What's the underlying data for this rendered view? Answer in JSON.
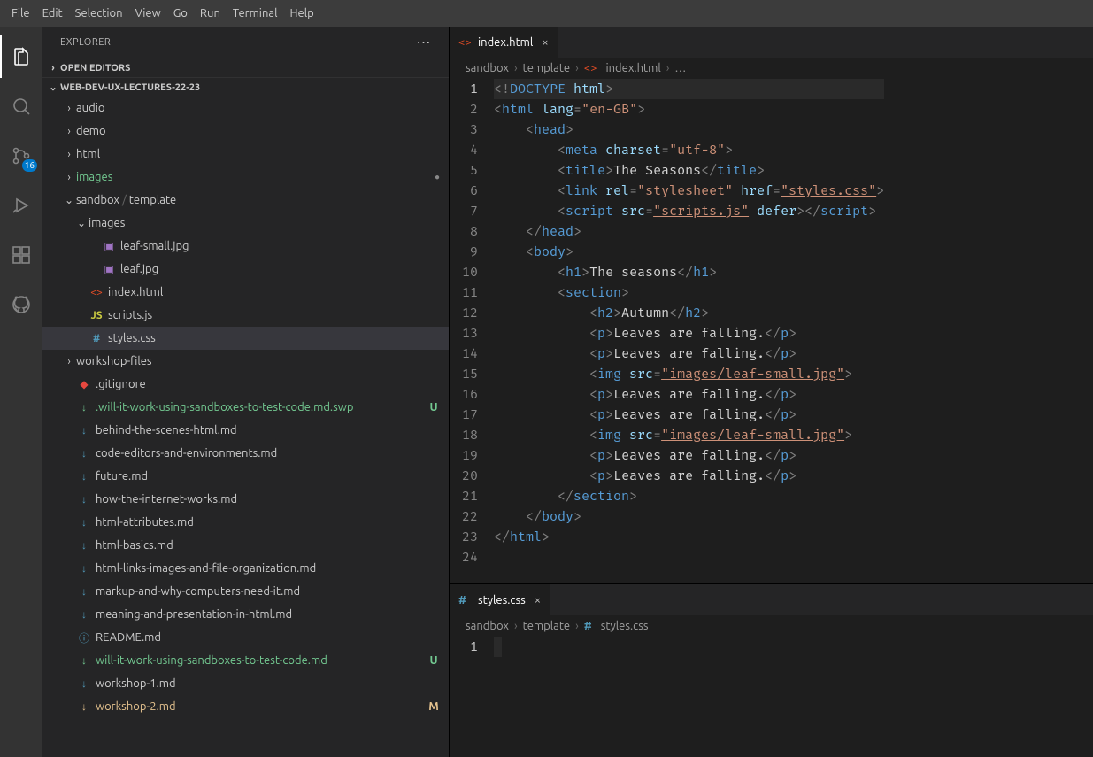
{
  "menu": [
    "File",
    "Edit",
    "Selection",
    "View",
    "Go",
    "Run",
    "Terminal",
    "Help"
  ],
  "sidebar": {
    "title": "EXPLORER",
    "sections": {
      "open_editors": "OPEN EDITORS",
      "folder": "WEB-DEV-UX-LECTURES-22-23"
    }
  },
  "scm_badge": "16",
  "tree": [
    {
      "depth": 1,
      "chev": ">",
      "type": "folder",
      "label": "audio"
    },
    {
      "depth": 1,
      "chev": ">",
      "type": "folder",
      "label": "demo"
    },
    {
      "depth": 1,
      "chev": ">",
      "type": "folder",
      "label": "html"
    },
    {
      "depth": 1,
      "chev": ">",
      "type": "folder",
      "label": "images",
      "status": "untracked",
      "dot": true
    },
    {
      "depth": 1,
      "chev": "v",
      "type": "folder",
      "label": "sandbox / template",
      "breadcrumb": true
    },
    {
      "depth": 2,
      "chev": "v",
      "type": "folder",
      "label": "images"
    },
    {
      "depth": 3,
      "type": "image",
      "label": "leaf-small.jpg"
    },
    {
      "depth": 3,
      "type": "image",
      "label": "leaf.jpg"
    },
    {
      "depth": 2,
      "type": "html",
      "label": "index.html"
    },
    {
      "depth": 2,
      "type": "js",
      "label": "scripts.js"
    },
    {
      "depth": 2,
      "type": "css",
      "label": "styles.css",
      "selected": true
    },
    {
      "depth": 1,
      "chev": ">",
      "type": "folder",
      "label": "workshop-files"
    },
    {
      "depth": 1,
      "type": "git",
      "label": ".gitignore"
    },
    {
      "depth": 1,
      "type": "md",
      "label": ".will-it-work-using-sandboxes-to-test-code.md.swp",
      "status": "untracked",
      "git": "U"
    },
    {
      "depth": 1,
      "type": "md",
      "label": "behind-the-scenes-html.md"
    },
    {
      "depth": 1,
      "type": "md",
      "label": "code-editors-and-environments.md"
    },
    {
      "depth": 1,
      "type": "md",
      "label": "future.md"
    },
    {
      "depth": 1,
      "type": "md",
      "label": "how-the-internet-works.md"
    },
    {
      "depth": 1,
      "type": "md",
      "label": "html-attributes.md"
    },
    {
      "depth": 1,
      "type": "md",
      "label": "html-basics.md"
    },
    {
      "depth": 1,
      "type": "md",
      "label": "html-links-images-and-file-organization.md"
    },
    {
      "depth": 1,
      "type": "md",
      "label": "markup-and-why-computers-need-it.md"
    },
    {
      "depth": 1,
      "type": "md",
      "label": "meaning-and-presentation-in-html.md"
    },
    {
      "depth": 1,
      "type": "info",
      "label": "README.md"
    },
    {
      "depth": 1,
      "type": "md",
      "label": "will-it-work-using-sandboxes-to-test-code.md",
      "status": "untracked",
      "git": "U"
    },
    {
      "depth": 1,
      "type": "md",
      "label": "workshop-1.md"
    },
    {
      "depth": 1,
      "type": "md",
      "label": "workshop-2.md",
      "status": "modified",
      "git": "M"
    }
  ],
  "top_editor": {
    "tab": {
      "icon": "html",
      "label": "index.html"
    },
    "breadcrumb": [
      "sandbox",
      "template",
      "index.html",
      "…"
    ],
    "breadcrumb_icons": [
      null,
      null,
      "html",
      null
    ],
    "lines": [
      [
        [
          "a",
          "<"
        ],
        [
          "b",
          "!"
        ],
        [
          "doctype",
          "DOCTYPE "
        ],
        [
          "attr",
          "html"
        ],
        [
          "a",
          ">"
        ]
      ],
      [
        [
          "a",
          "<"
        ],
        [
          "tag",
          "html "
        ],
        [
          "attr",
          "lang"
        ],
        [
          "a",
          "="
        ],
        [
          "str",
          "\"en-GB\""
        ],
        [
          "a",
          ">"
        ]
      ],
      [
        [
          "sp",
          "    "
        ],
        [
          "a",
          "<"
        ],
        [
          "tag",
          "head"
        ],
        [
          "a",
          ">"
        ]
      ],
      [
        [
          "sp",
          "        "
        ],
        [
          "a",
          "<"
        ],
        [
          "tag",
          "meta "
        ],
        [
          "attr",
          "charset"
        ],
        [
          "a",
          "="
        ],
        [
          "str",
          "\"utf-8\""
        ],
        [
          "a",
          ">"
        ]
      ],
      [
        [
          "sp",
          "        "
        ],
        [
          "a",
          "<"
        ],
        [
          "tag",
          "title"
        ],
        [
          "a",
          ">"
        ],
        [
          "txt",
          "The Seasons"
        ],
        [
          "a",
          "</"
        ],
        [
          "tag",
          "title"
        ],
        [
          "a",
          ">"
        ]
      ],
      [
        [
          "sp",
          "        "
        ],
        [
          "a",
          "<"
        ],
        [
          "tag",
          "link "
        ],
        [
          "attr",
          "rel"
        ],
        [
          "a",
          "="
        ],
        [
          "str",
          "\"stylesheet\""
        ],
        [
          "txt",
          " "
        ],
        [
          "attr",
          "href"
        ],
        [
          "a",
          "="
        ],
        [
          "stru",
          "\"styles.css\""
        ],
        [
          "a",
          ">"
        ]
      ],
      [
        [
          "sp",
          "        "
        ],
        [
          "a",
          "<"
        ],
        [
          "tag",
          "script "
        ],
        [
          "attr",
          "src"
        ],
        [
          "a",
          "="
        ],
        [
          "stru",
          "\"scripts.js\""
        ],
        [
          "txt",
          " "
        ],
        [
          "attr",
          "defer"
        ],
        [
          "a",
          "></"
        ],
        [
          "tag",
          "script"
        ],
        [
          "a",
          ">"
        ]
      ],
      [
        [
          "sp",
          "    "
        ],
        [
          "a",
          "</"
        ],
        [
          "tag",
          "head"
        ],
        [
          "a",
          ">"
        ]
      ],
      [
        [
          "sp",
          "    "
        ],
        [
          "a",
          "<"
        ],
        [
          "tag",
          "body"
        ],
        [
          "a",
          ">"
        ]
      ],
      [
        [
          "sp",
          "        "
        ],
        [
          "a",
          "<"
        ],
        [
          "tag",
          "h1"
        ],
        [
          "a",
          ">"
        ],
        [
          "txt",
          "The seasons"
        ],
        [
          "a",
          "</"
        ],
        [
          "tag",
          "h1"
        ],
        [
          "a",
          ">"
        ]
      ],
      [
        [
          "sp",
          "        "
        ],
        [
          "a",
          "<"
        ],
        [
          "tag",
          "section"
        ],
        [
          "a",
          ">"
        ]
      ],
      [
        [
          "sp",
          "            "
        ],
        [
          "a",
          "<"
        ],
        [
          "tag",
          "h2"
        ],
        [
          "a",
          ">"
        ],
        [
          "txt",
          "Autumn"
        ],
        [
          "a",
          "</"
        ],
        [
          "tag",
          "h2"
        ],
        [
          "a",
          ">"
        ]
      ],
      [
        [
          "sp",
          "            "
        ],
        [
          "a",
          "<"
        ],
        [
          "tag",
          "p"
        ],
        [
          "a",
          ">"
        ],
        [
          "txt",
          "Leaves are falling."
        ],
        [
          "a",
          "</"
        ],
        [
          "tag",
          "p"
        ],
        [
          "a",
          ">"
        ]
      ],
      [
        [
          "sp",
          "            "
        ],
        [
          "a",
          "<"
        ],
        [
          "tag",
          "p"
        ],
        [
          "a",
          ">"
        ],
        [
          "txt",
          "Leaves are falling."
        ],
        [
          "a",
          "</"
        ],
        [
          "tag",
          "p"
        ],
        [
          "a",
          ">"
        ]
      ],
      [
        [
          "sp",
          "            "
        ],
        [
          "a",
          "<"
        ],
        [
          "tag",
          "img "
        ],
        [
          "attr",
          "src"
        ],
        [
          "a",
          "="
        ],
        [
          "stru",
          "\"images/leaf-small.jpg\""
        ],
        [
          "a",
          ">"
        ]
      ],
      [
        [
          "sp",
          "            "
        ],
        [
          "a",
          "<"
        ],
        [
          "tag",
          "p"
        ],
        [
          "a",
          ">"
        ],
        [
          "txt",
          "Leaves are falling."
        ],
        [
          "a",
          "</"
        ],
        [
          "tag",
          "p"
        ],
        [
          "a",
          ">"
        ]
      ],
      [
        [
          "sp",
          "            "
        ],
        [
          "a",
          "<"
        ],
        [
          "tag",
          "p"
        ],
        [
          "a",
          ">"
        ],
        [
          "txt",
          "Leaves are falling."
        ],
        [
          "a",
          "</"
        ],
        [
          "tag",
          "p"
        ],
        [
          "a",
          ">"
        ]
      ],
      [
        [
          "sp",
          "            "
        ],
        [
          "a",
          "<"
        ],
        [
          "tag",
          "img "
        ],
        [
          "attr",
          "src"
        ],
        [
          "a",
          "="
        ],
        [
          "stru",
          "\"images/leaf-small.jpg\""
        ],
        [
          "a",
          ">"
        ]
      ],
      [
        [
          "sp",
          "            "
        ],
        [
          "a",
          "<"
        ],
        [
          "tag",
          "p"
        ],
        [
          "a",
          ">"
        ],
        [
          "txt",
          "Leaves are falling."
        ],
        [
          "a",
          "</"
        ],
        [
          "tag",
          "p"
        ],
        [
          "a",
          ">"
        ]
      ],
      [
        [
          "sp",
          "            "
        ],
        [
          "a",
          "<"
        ],
        [
          "tag",
          "p"
        ],
        [
          "a",
          ">"
        ],
        [
          "txt",
          "Leaves are falling."
        ],
        [
          "a",
          "</"
        ],
        [
          "tag",
          "p"
        ],
        [
          "a",
          ">"
        ]
      ],
      [
        [
          "sp",
          "        "
        ],
        [
          "a",
          "</"
        ],
        [
          "tag",
          "section"
        ],
        [
          "a",
          ">"
        ]
      ],
      [
        [
          "sp",
          "    "
        ],
        [
          "a",
          "</"
        ],
        [
          "tag",
          "body"
        ],
        [
          "a",
          ">"
        ]
      ],
      [
        [
          "a",
          "</"
        ],
        [
          "tag",
          "html"
        ],
        [
          "a",
          ">"
        ]
      ],
      [
        [
          "txt",
          ""
        ]
      ]
    ]
  },
  "bottom_editor": {
    "tab": {
      "icon": "css",
      "label": "styles.css"
    },
    "breadcrumb": [
      "sandbox",
      "template",
      "styles.css"
    ],
    "breadcrumb_icons": [
      null,
      null,
      "css"
    ],
    "lines": [
      [
        [
          "txt",
          ""
        ]
      ]
    ]
  }
}
